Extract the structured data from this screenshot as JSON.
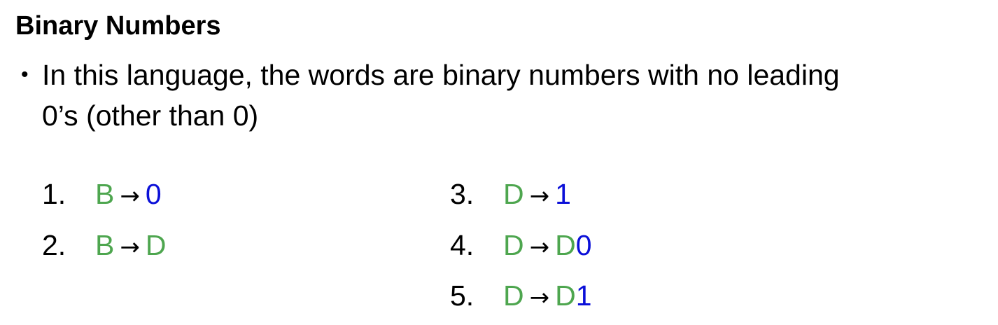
{
  "title": "Binary Numbers",
  "bullet": {
    "line1": "In this language, the words are binary numbers with no leading",
    "line2": "0’s (other than 0)"
  },
  "arrow_glyph": "→",
  "colors": {
    "nonterminal": "#4ea64f",
    "terminal": "#0b10d8",
    "text": "#000000"
  },
  "rules": [
    {
      "num": "1.",
      "lhs": "B",
      "rhs_nt": "",
      "rhs_t": "0"
    },
    {
      "num": "2.",
      "lhs": "B",
      "rhs_nt": "D",
      "rhs_t": ""
    },
    {
      "num": "3.",
      "lhs": "D",
      "rhs_nt": "",
      "rhs_t": "1"
    },
    {
      "num": "4.",
      "lhs": "D",
      "rhs_nt": "D",
      "rhs_t": "0"
    },
    {
      "num": "5.",
      "lhs": "D",
      "rhs_nt": "D",
      "rhs_t": "1"
    }
  ]
}
